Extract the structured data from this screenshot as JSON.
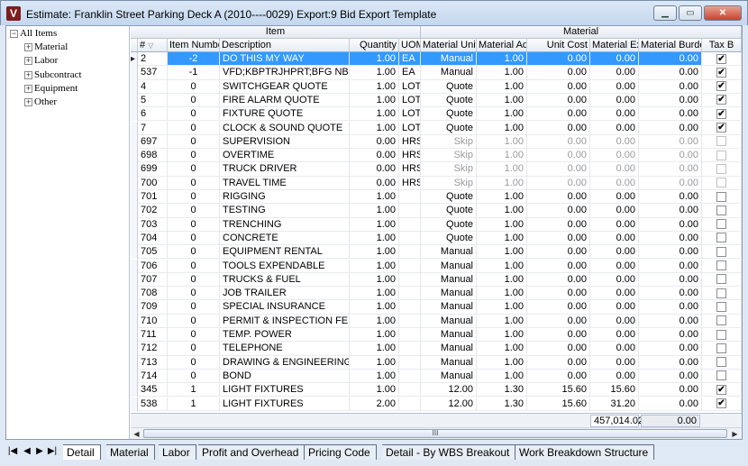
{
  "window": {
    "app_icon": "V",
    "title": "Estimate: Franklin Street Parking Deck A (2010----0029)    Export:9 Bid Export Template",
    "minimize_icon": "minimize-icon",
    "maximize_icon": "maximize-icon",
    "close_icon": "close-icon"
  },
  "tree": {
    "root": "All Items",
    "children": [
      "Material",
      "Labor",
      "Subcontract",
      "Equipment",
      "Other"
    ]
  },
  "grid": {
    "bands": {
      "item": "Item",
      "material": "Material"
    },
    "columns": [
      "#",
      "Item Number",
      "Description",
      "Quantity",
      "UOM",
      "Material Unit",
      "Material Adj",
      "Unit Cost",
      "Material Ext",
      "Material Burden",
      "Tax B"
    ],
    "rows": [
      {
        "n": "2",
        "item": "-2",
        "desc": "DO THIS MY WAY",
        "qty": "1.00",
        "uom": "EA",
        "unit": "Manual",
        "adj": "1.00",
        "cost": "0.00",
        "ext": "0.00",
        "burden": "0.00",
        "tax": true
      },
      {
        "n": "537",
        "item": "-1",
        "desc": "VFD;KBPTRJHPRT;BFG NB;F B...",
        "qty": "1.00",
        "uom": "EA",
        "unit": "Manual",
        "adj": "1.00",
        "cost": "0.00",
        "ext": "0.00",
        "burden": "0.00",
        "tax": true
      },
      {
        "n": "4",
        "item": "0",
        "desc": "SWITCHGEAR QUOTE",
        "qty": "1.00",
        "uom": "LOT",
        "unit": "Quote",
        "adj": "1.00",
        "cost": "0.00",
        "ext": "0.00",
        "burden": "0.00",
        "tax": true
      },
      {
        "n": "5",
        "item": "0",
        "desc": "FIRE ALARM QUOTE",
        "qty": "1.00",
        "uom": "LOT",
        "unit": "Quote",
        "adj": "1.00",
        "cost": "0.00",
        "ext": "0.00",
        "burden": "0.00",
        "tax": true
      },
      {
        "n": "6",
        "item": "0",
        "desc": "FIXTURE QUOTE",
        "qty": "1.00",
        "uom": "LOT",
        "unit": "Quote",
        "adj": "1.00",
        "cost": "0.00",
        "ext": "0.00",
        "burden": "0.00",
        "tax": true
      },
      {
        "n": "7",
        "item": "0",
        "desc": "CLOCK & SOUND QUOTE",
        "qty": "1.00",
        "uom": "LOT",
        "unit": "Quote",
        "adj": "1.00",
        "cost": "0.00",
        "ext": "0.00",
        "burden": "0.00",
        "tax": true
      },
      {
        "n": "697",
        "item": "0",
        "desc": "SUPERVISION",
        "qty": "0.00",
        "uom": "HRS",
        "unit": "Skip",
        "adj": "1.00",
        "cost": "0.00",
        "ext": "0.00",
        "burden": "0.00",
        "tax": false,
        "grey": true
      },
      {
        "n": "698",
        "item": "0",
        "desc": "OVERTIME",
        "qty": "0.00",
        "uom": "HRS",
        "unit": "Skip",
        "adj": "1.00",
        "cost": "0.00",
        "ext": "0.00",
        "burden": "0.00",
        "tax": false,
        "grey": true
      },
      {
        "n": "699",
        "item": "0",
        "desc": "TRUCK DRIVER",
        "qty": "0.00",
        "uom": "HRS",
        "unit": "Skip",
        "adj": "1.00",
        "cost": "0.00",
        "ext": "0.00",
        "burden": "0.00",
        "tax": false,
        "grey": true
      },
      {
        "n": "700",
        "item": "0",
        "desc": "TRAVEL TIME",
        "qty": "0.00",
        "uom": "HRS",
        "unit": "Skip",
        "adj": "1.00",
        "cost": "0.00",
        "ext": "0.00",
        "burden": "0.00",
        "tax": false,
        "grey": true
      },
      {
        "n": "701",
        "item": "0",
        "desc": "RIGGING",
        "qty": "1.00",
        "uom": "",
        "unit": "Quote",
        "adj": "1.00",
        "cost": "0.00",
        "ext": "0.00",
        "burden": "0.00",
        "tax": false
      },
      {
        "n": "702",
        "item": "0",
        "desc": "TESTING",
        "qty": "1.00",
        "uom": "",
        "unit": "Quote",
        "adj": "1.00",
        "cost": "0.00",
        "ext": "0.00",
        "burden": "0.00",
        "tax": false
      },
      {
        "n": "703",
        "item": "0",
        "desc": "TRENCHING",
        "qty": "1.00",
        "uom": "",
        "unit": "Quote",
        "adj": "1.00",
        "cost": "0.00",
        "ext": "0.00",
        "burden": "0.00",
        "tax": false
      },
      {
        "n": "704",
        "item": "0",
        "desc": "CONCRETE",
        "qty": "1.00",
        "uom": "",
        "unit": "Quote",
        "adj": "1.00",
        "cost": "0.00",
        "ext": "0.00",
        "burden": "0.00",
        "tax": false
      },
      {
        "n": "705",
        "item": "0",
        "desc": "EQUIPMENT RENTAL",
        "qty": "1.00",
        "uom": "",
        "unit": "Manual",
        "adj": "1.00",
        "cost": "0.00",
        "ext": "0.00",
        "burden": "0.00",
        "tax": false
      },
      {
        "n": "706",
        "item": "0",
        "desc": "TOOLS EXPENDABLE",
        "qty": "1.00",
        "uom": "",
        "unit": "Manual",
        "adj": "1.00",
        "cost": "0.00",
        "ext": "0.00",
        "burden": "0.00",
        "tax": false
      },
      {
        "n": "707",
        "item": "0",
        "desc": "TRUCKS & FUEL",
        "qty": "1.00",
        "uom": "",
        "unit": "Manual",
        "adj": "1.00",
        "cost": "0.00",
        "ext": "0.00",
        "burden": "0.00",
        "tax": false
      },
      {
        "n": "708",
        "item": "0",
        "desc": "JOB TRAILER",
        "qty": "1.00",
        "uom": "",
        "unit": "Manual",
        "adj": "1.00",
        "cost": "0.00",
        "ext": "0.00",
        "burden": "0.00",
        "tax": false
      },
      {
        "n": "709",
        "item": "0",
        "desc": "SPECIAL INSURANCE",
        "qty": "1.00",
        "uom": "",
        "unit": "Manual",
        "adj": "1.00",
        "cost": "0.00",
        "ext": "0.00",
        "burden": "0.00",
        "tax": false
      },
      {
        "n": "710",
        "item": "0",
        "desc": "PERMIT & INSPECTION FEES",
        "qty": "1.00",
        "uom": "",
        "unit": "Manual",
        "adj": "1.00",
        "cost": "0.00",
        "ext": "0.00",
        "burden": "0.00",
        "tax": false
      },
      {
        "n": "711",
        "item": "0",
        "desc": "TEMP. POWER",
        "qty": "1.00",
        "uom": "",
        "unit": "Manual",
        "adj": "1.00",
        "cost": "0.00",
        "ext": "0.00",
        "burden": "0.00",
        "tax": false
      },
      {
        "n": "712",
        "item": "0",
        "desc": "TELEPHONE",
        "qty": "1.00",
        "uom": "",
        "unit": "Manual",
        "adj": "1.00",
        "cost": "0.00",
        "ext": "0.00",
        "burden": "0.00",
        "tax": false
      },
      {
        "n": "713",
        "item": "0",
        "desc": "DRAWING & ENGINEERING",
        "qty": "1.00",
        "uom": "",
        "unit": "Manual",
        "adj": "1.00",
        "cost": "0.00",
        "ext": "0.00",
        "burden": "0.00",
        "tax": false
      },
      {
        "n": "714",
        "item": "0",
        "desc": "BOND",
        "qty": "1.00",
        "uom": "",
        "unit": "Manual",
        "adj": "1.00",
        "cost": "0.00",
        "ext": "0.00",
        "burden": "0.00",
        "tax": false
      },
      {
        "n": "345",
        "item": "1",
        "desc": "LIGHT FIXTURES",
        "qty": "1.00",
        "uom": "",
        "unit": "12.00",
        "adj": "1.30",
        "cost": "15.60",
        "ext": "15.60",
        "burden": "0.00",
        "tax": true
      },
      {
        "n": "538",
        "item": "1",
        "desc": "LIGHT FIXTURES",
        "qty": "2.00",
        "uom": "",
        "unit": "12.00",
        "adj": "1.30",
        "cost": "15.60",
        "ext": "31.20",
        "burden": "0.00",
        "tax": true
      }
    ],
    "totals": {
      "material_ext": "457,014.02",
      "material_burden": "0.00"
    },
    "hscroll_grip": "III"
  },
  "tabs": {
    "nav_first": "|◀",
    "nav_prev": "◀",
    "nav_next": "▶",
    "nav_last": "▶|",
    "items": [
      "Detail",
      "Material",
      "Labor",
      "Profit and Overhead",
      "Pricing Code",
      "Detail - By WBS Breakout",
      "Work Breakdown Structure"
    ],
    "active": "Detail"
  },
  "colors": {
    "selection": "#3399ff",
    "title_bar": "#c4d7ee",
    "close_button": "#c6452f"
  }
}
